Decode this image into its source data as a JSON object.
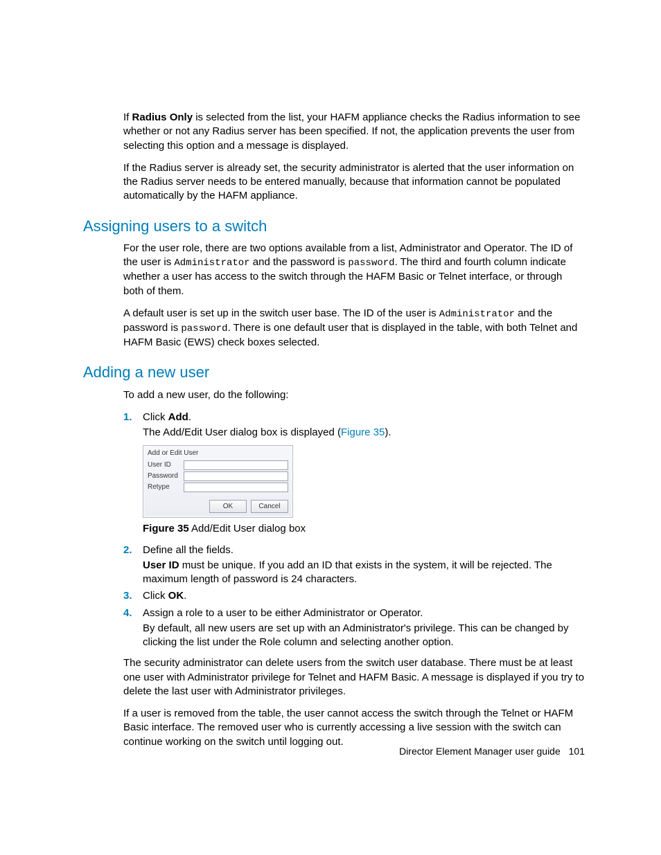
{
  "para1": {
    "pre": "If ",
    "bold": "Radius Only",
    "post": " is selected from the list, your HAFM appliance checks the Radius information to see whether or not any Radius server has been specified. If not, the application prevents the user from selecting this option and a message is displayed."
  },
  "para2": "If the Radius server is already set, the security administrator is alerted that the user information on the Radius server needs to be entered manually, because that information cannot be populated automatically by the HAFM appliance.",
  "heading1": "Assigning users to a switch",
  "assign1": {
    "a": "For the user role, there are two options available from a list, Administrator and Operator. The ID of the user is ",
    "m1": "Administrator",
    "b": " and the password is ",
    "m2": "password",
    "c": ". The third and fourth column indicate whether a user has access to the switch through the HAFM Basic or Telnet interface, or through both of them."
  },
  "assign2": {
    "a": "A default user is set up in the switch user base. The ID of the user is ",
    "m1": "Administrator",
    "b": " and the password is ",
    "m2": "password",
    "c": ". There is one default user that is displayed in the table, with both Telnet and HAFM Basic (EWS) check boxes selected."
  },
  "heading2": "Adding a new user",
  "add_intro": "To add a new user, do the following:",
  "steps": {
    "s1": {
      "num": "1.",
      "pre": "Click ",
      "bold": "Add",
      "post": ".",
      "sub_a": "The Add/Edit User dialog box is displayed (",
      "sub_link": "Figure 35",
      "sub_b": ")."
    },
    "s2": {
      "num": "2.",
      "text": "Define all the fields.",
      "sub_bold": "User ID",
      "sub_rest": " must be unique. If you add an ID that exists in the system, it will be rejected. The maximum length of password is 24 characters."
    },
    "s3": {
      "num": "3.",
      "pre": "Click ",
      "bold": "OK",
      "post": "."
    },
    "s4": {
      "num": "4.",
      "text": "Assign a role to a user to be either Administrator or Operator.",
      "sub": "By default, all new users are set up with an Administrator's privilege. This can be changed by clicking the list under the Role column and selecting another option."
    }
  },
  "dialog": {
    "title": "Add or Edit User",
    "userid": "User ID",
    "password": "Password",
    "retype": "Retype",
    "ok": "OK",
    "cancel": "Cancel"
  },
  "figcap": {
    "num": "Figure 35",
    "text": " Add/Edit User dialog box"
  },
  "tail1": "The security administrator can delete users from the switch user database. There must be at least one user with Administrator privilege for Telnet and HAFM Basic. A message is displayed if you try to delete the last user with Administrator privileges.",
  "tail2": "If a user is removed from the table, the user cannot access the switch through the Telnet or HAFM Basic interface. The removed user who is currently accessing a live session with the switch can continue working on the switch until logging out.",
  "footer": {
    "title": "Director Element Manager user guide",
    "page": "101"
  }
}
